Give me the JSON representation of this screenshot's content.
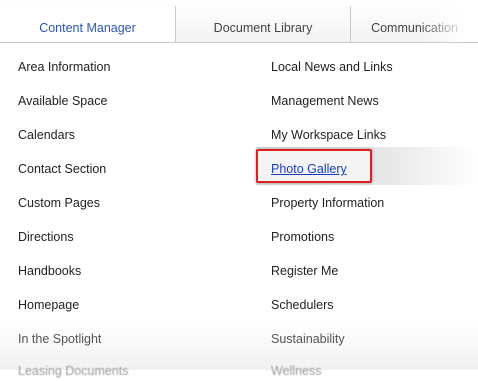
{
  "tabs": [
    {
      "label": "Content Manager",
      "active": true
    },
    {
      "label": "Document Library",
      "active": false
    },
    {
      "label": "Communication",
      "active": false
    }
  ],
  "menu": {
    "left": [
      "Area Information",
      "Available Space",
      "Calendars",
      "Contact Section",
      "Custom Pages",
      "Directions",
      "Handbooks",
      "Homepage",
      "In the Spotlight",
      "Leasing Documents"
    ],
    "right": [
      "Local News and Links",
      "Management News",
      "My Workspace Links",
      "Photo Gallery",
      "Property Information",
      "Promotions",
      "Register Me",
      "Schedulers",
      "Sustainability",
      "Wellness"
    ],
    "highlighted": "Photo Gallery"
  },
  "colors": {
    "active_tab": "#2a56b2",
    "link": "#1a3fb8",
    "highlight_border": "#e01f1f"
  }
}
